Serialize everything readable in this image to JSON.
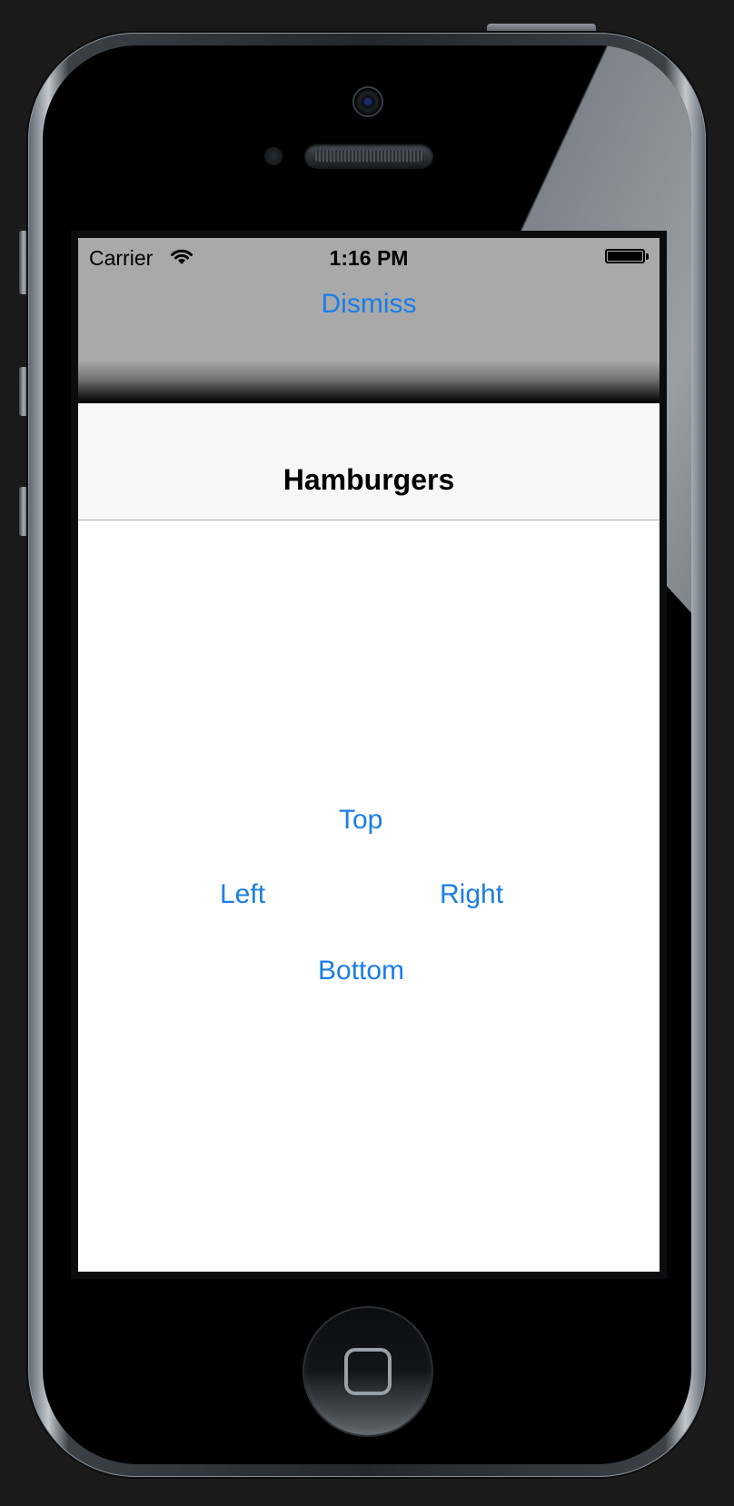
{
  "status_bar": {
    "carrier": "Carrier",
    "time": "1:16 PM",
    "wifi_icon": "wifi-icon",
    "battery_icon": "battery-full-icon"
  },
  "modal_header": {
    "dismiss_label": "Dismiss"
  },
  "navbar": {
    "title": "Hamburgers"
  },
  "content": {
    "buttons": {
      "top": "Top",
      "left": "Left",
      "right": "Right",
      "bottom": "Bottom"
    }
  },
  "device": {
    "home_button_icon": "home-square-icon"
  },
  "colors": {
    "tint": "#1a7ee6",
    "header_gray": "#a9a9a9",
    "navbar_bg": "#f7f7f7"
  }
}
